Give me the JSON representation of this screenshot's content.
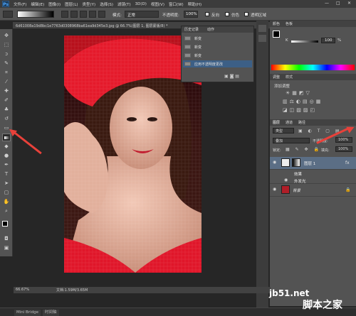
{
  "menubar": {
    "logo": "Ps",
    "items": [
      "文件(F)",
      "编辑(E)",
      "图像(I)",
      "图层(L)",
      "类型(Y)",
      "选择(S)",
      "滤镜(T)",
      "3D(D)",
      "视图(V)",
      "窗口(W)",
      "帮助(H)"
    ],
    "window_controls": [
      "—",
      "□",
      "✕"
    ]
  },
  "options_bar": {
    "mode_label": "模式:",
    "mode_value": "正常",
    "opacity_label": "不透明度:",
    "opacity_value": "100%",
    "reverse_label": "反向",
    "dither_label": "仿色",
    "transparency_label": "透明区域"
  },
  "document": {
    "tab_title": "6d61008a19d8bc1e7763d0308968ba61ea9d345e3.jpg @ 66.7%(图层 1, 图层蒙版/8) *",
    "zoom": "66.67%",
    "doc_size": "文档:1.59M/3.65M"
  },
  "history_panel": {
    "tabs": [
      "历史记录",
      "动作"
    ],
    "items": [
      "新变",
      "新变",
      "新变",
      "应用不透明度更改"
    ],
    "selected_index": 3
  },
  "swatches": {
    "tabs": [
      "颜色",
      "色板"
    ],
    "slider_label": "K",
    "slider_value": "100",
    "slider_unit": "%"
  },
  "adjustments": {
    "tabs": [
      "调整",
      "样式"
    ],
    "title": "添加调整"
  },
  "layers_panel": {
    "tabs": [
      "图层",
      "通道",
      "路径"
    ],
    "kind_label": "类型",
    "blend_mode": "叠加",
    "opacity_label": "不透明度:",
    "opacity_value": "100%",
    "lock_label": "锁定:",
    "fill_label": "填充:",
    "fill_value": "100%",
    "layers": [
      {
        "name": "图层 1",
        "selected": true
      },
      {
        "name": "效果",
        "selected": false
      },
      {
        "name": "外发光",
        "selected": false
      },
      {
        "name": "背景",
        "selected": false
      }
    ]
  },
  "bottom_tabs": [
    "Mini Bridge",
    "时间轴"
  ],
  "watermark": {
    "line1": "jb51.net",
    "line2": "脚本之家"
  },
  "colors": {
    "accent_red": "#e8413a",
    "selection_blue": "#3c5f86",
    "layer_selected": "#5b6e85"
  }
}
